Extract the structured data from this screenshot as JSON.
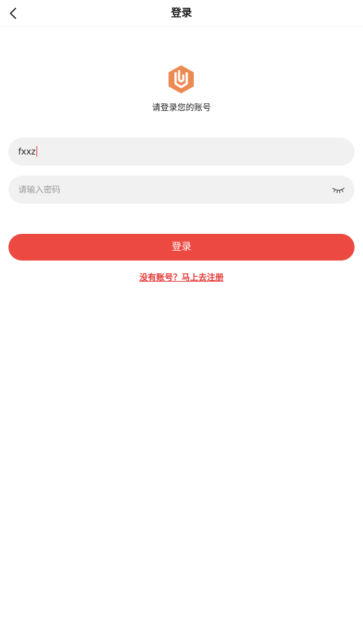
{
  "header": {
    "title": "登录",
    "back_icon": "chevron-left-icon"
  },
  "logo": {
    "icon": "brand-logo-icon",
    "color": "#ec8a52"
  },
  "subtitle": "请登录您的账号",
  "form": {
    "username_value": "fxxz",
    "password_placeholder": "请输入密码",
    "password_toggle_icon": "eye-closed-icon"
  },
  "login_button_label": "登录",
  "register_link": "没有账号？马上去注册",
  "colors": {
    "accent": "#ec4a41",
    "field_bg": "#f1f1f1",
    "link": "#e53935"
  }
}
